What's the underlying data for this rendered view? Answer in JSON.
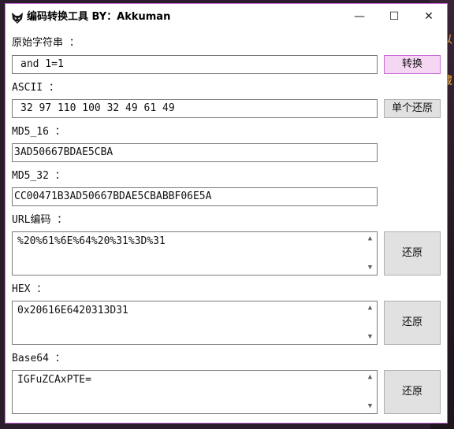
{
  "window": {
    "title": "编码转换工具 BY：Akkuman",
    "minimize_glyph": "—",
    "maximize_glyph": "☐",
    "close_glyph": "✕",
    "app_icon": "fox-icon"
  },
  "fields": {
    "original": {
      "label": "原始字符串 ：",
      "value": " and 1=1",
      "button": "转换"
    },
    "ascii": {
      "label": "ASCII ：",
      "value": " 32 97 110 100 32 49 61 49",
      "button": "单个还原"
    },
    "md5_16": {
      "label": "MD5_16 ：",
      "value": "3AD50667BDAE5CBA"
    },
    "md5_32": {
      "label": "MD5_32 ：",
      "value": "CC00471B3AD50667BDAE5CBABBF06E5A"
    },
    "url": {
      "label": "URL编码 ：",
      "value": "%20%61%6E%64%20%31%3D%31",
      "button": "还原"
    },
    "hex": {
      "label": "HEX ：",
      "value": "0x20616E6420313D31",
      "button": "还原"
    },
    "base64": {
      "label": "Base64 ：",
      "value": "IGFuZCAxPTE=",
      "button": "还原"
    }
  },
  "scrollbar": {
    "up_glyph": "▲",
    "down_glyph": "▼"
  },
  "background": {
    "glyphs": [
      "以",
      "藏",
      "P"
    ]
  },
  "colors": {
    "accent": "#c86bd8",
    "accent_fill": "#f5d7f4",
    "button": "#e1e1e1",
    "border": "#7a7a7a"
  }
}
